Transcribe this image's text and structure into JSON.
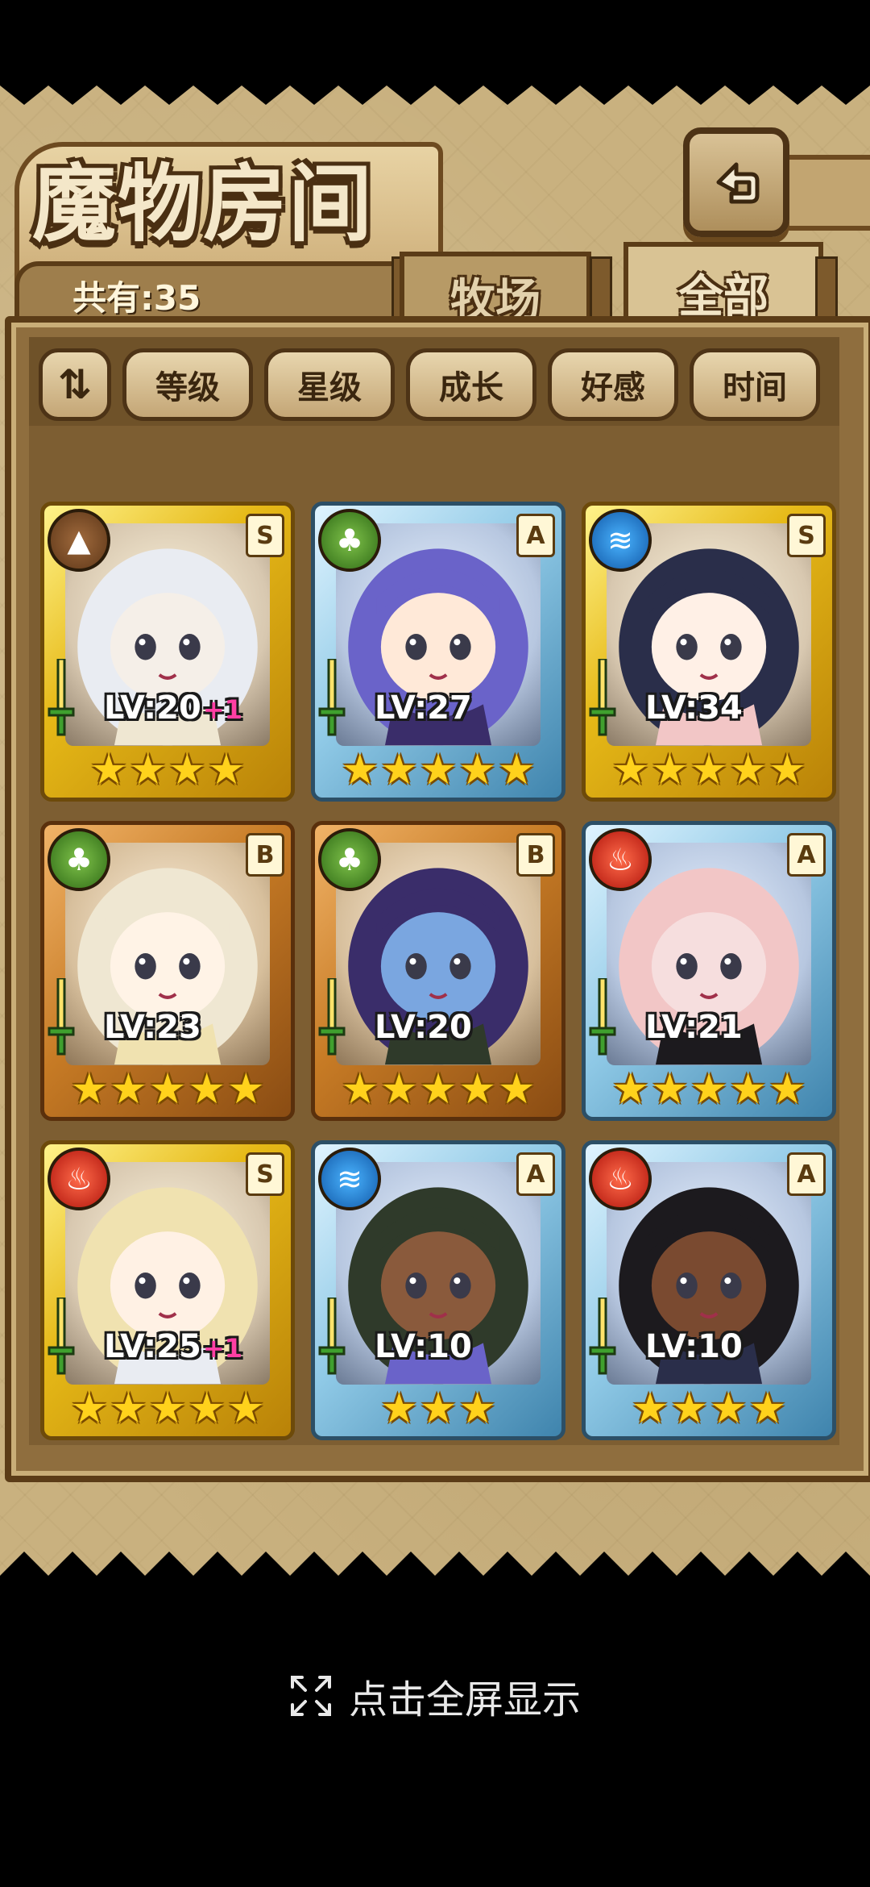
{
  "title": "魔物房间",
  "count_label": "共有:35",
  "tabs": [
    {
      "label": "牧场",
      "active": false
    },
    {
      "label": "全部",
      "active": true
    }
  ],
  "sort_toggle_label": "⇅",
  "filters": [
    "等级",
    "星级",
    "成长",
    "好感",
    "时间"
  ],
  "cards": [
    {
      "frame": "gold",
      "rank": "S",
      "element": "earth",
      "level": "LV:20",
      "bonus": "+1",
      "stars": 4
    },
    {
      "frame": "silver",
      "rank": "A",
      "element": "wood",
      "level": "LV:27",
      "bonus": "",
      "stars": 5
    },
    {
      "frame": "gold",
      "rank": "S",
      "element": "water",
      "level": "LV:34",
      "bonus": "",
      "stars": 5
    },
    {
      "frame": "bronze",
      "rank": "B",
      "element": "wood",
      "level": "LV:23",
      "bonus": "",
      "stars": 5
    },
    {
      "frame": "bronze",
      "rank": "B",
      "element": "wood",
      "level": "LV:20",
      "bonus": "",
      "stars": 5
    },
    {
      "frame": "silver",
      "rank": "A",
      "element": "fire",
      "level": "LV:21",
      "bonus": "",
      "stars": 5
    },
    {
      "frame": "gold",
      "rank": "S",
      "element": "fire",
      "level": "LV:25",
      "bonus": "+1",
      "stars": 5
    },
    {
      "frame": "silver",
      "rank": "A",
      "element": "water",
      "level": "LV:10",
      "bonus": "",
      "stars": 3
    },
    {
      "frame": "silver",
      "rank": "A",
      "element": "fire",
      "level": "LV:10",
      "bonus": "",
      "stars": 4
    }
  ],
  "fullscreen_hint": "点击全屏显示",
  "icons": {
    "back": "back-arrow-icon",
    "fullscreen": "fullscreen-expand-icon",
    "sword": "sword-icon",
    "star": "star-icon"
  }
}
